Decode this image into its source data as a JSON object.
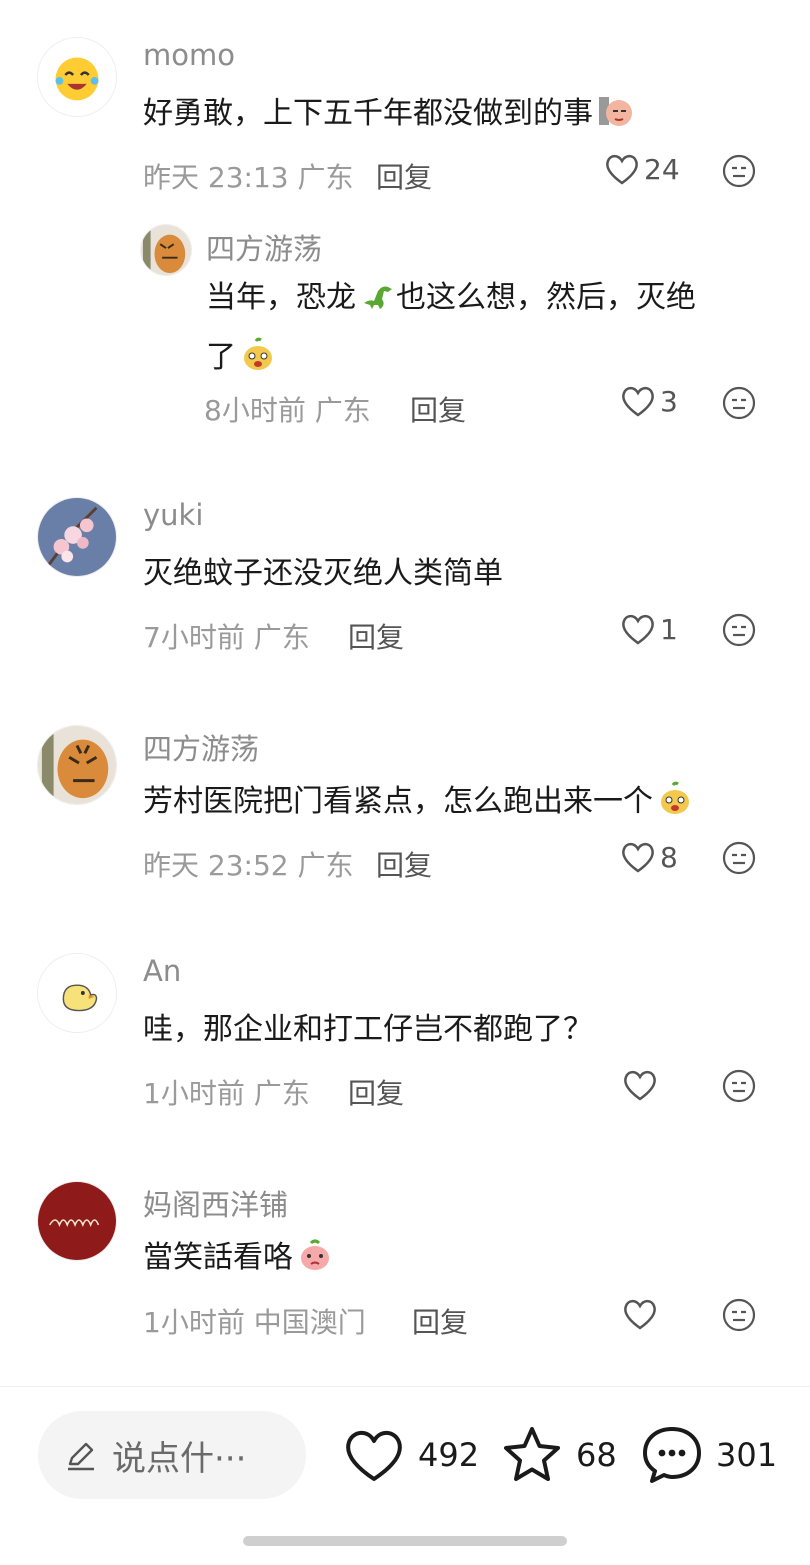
{
  "comments": [
    {
      "user": "momo",
      "text": "好勇敢，上下五千年都没做到的事",
      "time": "昨天 23:13",
      "location": "广东",
      "reply_label": "回复",
      "likes": "24",
      "replies": [
        {
          "user": "四方游荡",
          "text_line1": "当年，恐龙",
          "text_line1b": "也这么想，然后，灭绝",
          "text_line2": "了",
          "time": "8小时前",
          "location": "广东",
          "reply_label": "回复",
          "likes": "3"
        }
      ]
    },
    {
      "user": "yuki",
      "text": "灭绝蚊子还没灭绝人类简单",
      "time": "7小时前",
      "location": "广东",
      "reply_label": "回复",
      "likes": "1"
    },
    {
      "user": "四方游荡",
      "text": "芳村医院把门看紧点，怎么跑出来一个",
      "time": "昨天 23:52",
      "location": "广东",
      "reply_label": "回复",
      "likes": "8"
    },
    {
      "user": "An",
      "text": "哇，那企业和打工仔岂不都跑了？",
      "time": "1小时前",
      "location": "广东",
      "reply_label": "回复",
      "likes": ""
    },
    {
      "user": "妈阁西洋铺",
      "text": "當笑話看咯",
      "time": "1小时前",
      "location": "中国澳门",
      "reply_label": "回复",
      "likes": ""
    }
  ],
  "bottom_bar": {
    "input_placeholder": "说点什···",
    "likes": "492",
    "favorites": "68",
    "comments": "301"
  },
  "icons": {
    "like": "heart-outline-icon",
    "more": "emoji-face-icon",
    "edit": "pencil-icon",
    "favorite": "star-icon",
    "comment": "chat-bubble-icon"
  }
}
